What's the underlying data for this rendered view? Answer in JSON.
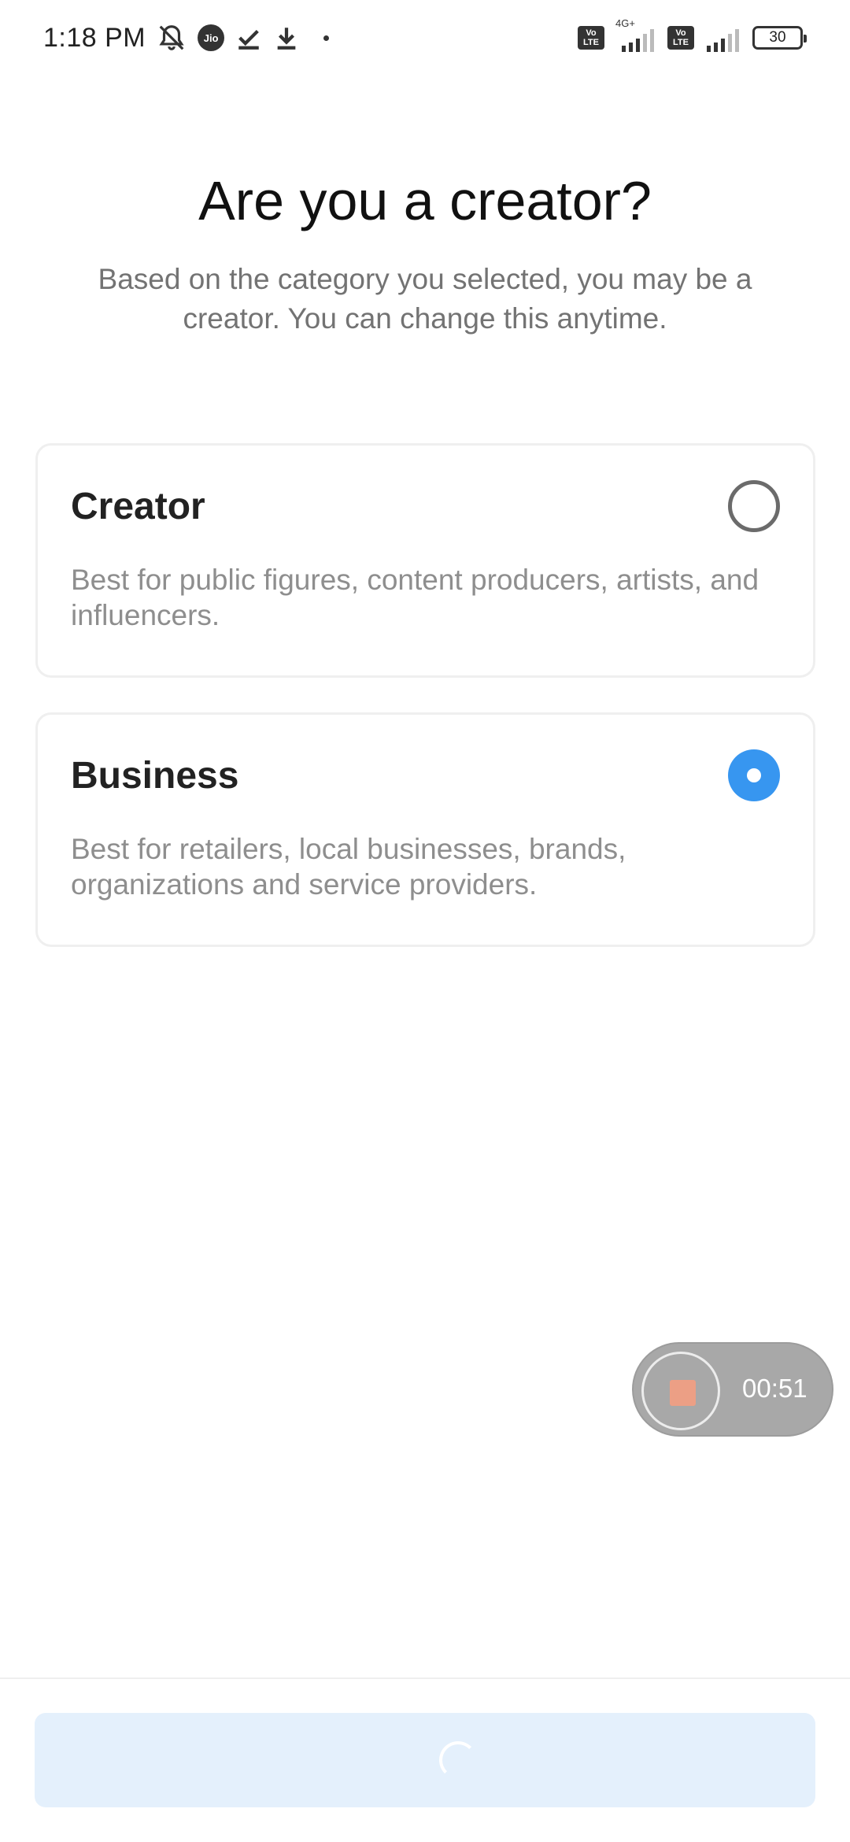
{
  "status_bar": {
    "time": "1:18 PM",
    "jio_label": "Jio",
    "volte_label_1": "Vo",
    "volte_label_2": "LTE",
    "network_type": "4G+",
    "battery_level": "30"
  },
  "header": {
    "title": "Are you a creator?",
    "subtitle": "Based on the category you selected, you may be a creator. You can change this anytime."
  },
  "options": [
    {
      "title": "Creator",
      "description": "Best for public figures, content producers, artists, and influencers.",
      "selected": false
    },
    {
      "title": "Business",
      "description": "Best for retailers, local businesses, brands, organizations and service providers.",
      "selected": true
    }
  ],
  "recorder": {
    "elapsed": "00:51"
  },
  "footer": {
    "next_button_state": "loading"
  },
  "colors": {
    "accent": "#3796f0",
    "button_bg": "#e4f0fc",
    "recorder_bg": "#a8a8a8",
    "record_stop": "#ec9f85"
  }
}
